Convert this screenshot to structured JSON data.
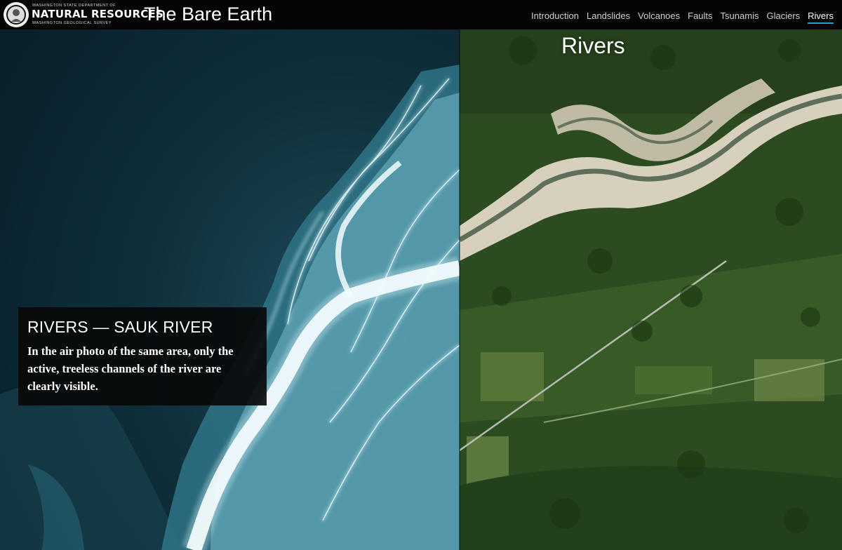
{
  "header": {
    "logo": {
      "top_line": "WASHINGTON STATE DEPARTMENT OF",
      "main": "NATURAL RESOURCES",
      "bottom_line": "WASHINGTON GEOLOGICAL SURVEY"
    },
    "site_title": "The Bare Earth"
  },
  "nav": {
    "items": [
      {
        "label": "Introduction"
      },
      {
        "label": "Landslides"
      },
      {
        "label": "Volcanoes"
      },
      {
        "label": "Faults"
      },
      {
        "label": "Tsunamis"
      },
      {
        "label": "Glaciers"
      },
      {
        "label": "Rivers"
      }
    ],
    "active": "Rivers",
    "accent_color": "#1ea3c7"
  },
  "main": {
    "right_title": "Rivers",
    "caption": {
      "title": "RIVERS — SAUK RIVER",
      "body": "In the air photo of the same area, only the active, treeless channels of the river are clearly visible."
    },
    "left_image": {
      "icon": "lidar-hillshade-image",
      "colors": {
        "background": "#0b2a35",
        "channel": "#e8f7fb"
      }
    },
    "right_image": {
      "icon": "aerial-photo-image",
      "colors": {
        "forest": "#28461c",
        "gravel": "#d7d0bd",
        "water": "#5f6e5b"
      }
    }
  }
}
